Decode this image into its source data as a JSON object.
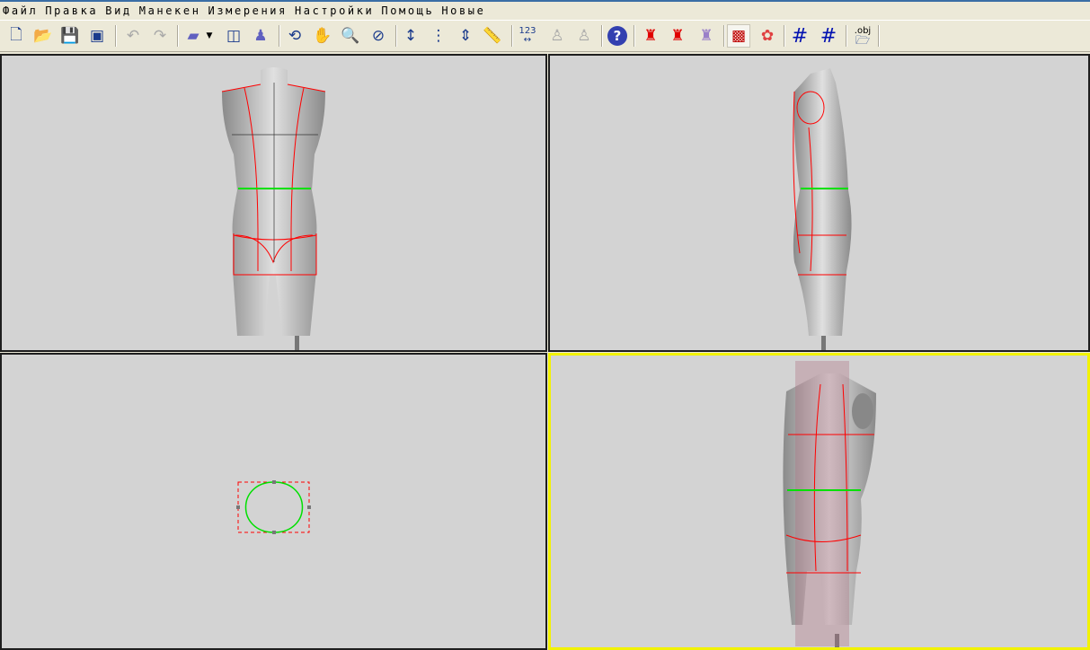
{
  "menu": [
    "Файл",
    "Правка",
    "Вид",
    "Манекен",
    "Измерения",
    "Настройки",
    "Помощь",
    "Новые"
  ],
  "toolbar": {
    "new": "new-file-icon",
    "open": "open-folder-icon",
    "save": "save-icon",
    "save_all": "save-image-icon",
    "undo": "undo-icon",
    "redo": "redo-icon",
    "mannequin_dropdown": "mannequin-select-icon",
    "layout": "layout-icon",
    "height": "figure-height-icon",
    "rotate": "rotate-icon",
    "pan": "hand-icon",
    "zoom": "magnifier-icon",
    "fit": "zoom-fit-icon",
    "measure_vertical": "vertical-measure-icon",
    "measure_dotted": "dotted-measure-icon",
    "measure_multi": "multi-measure-icon",
    "ruler": "ruler-icon",
    "numeric_label": "123",
    "help": "help-icon",
    "obj_label": ".obj"
  },
  "colors": {
    "viewport": "#d3d3d3",
    "active_border": "#f2f200",
    "line_red": "#ff0000",
    "line_green": "#00e000"
  }
}
